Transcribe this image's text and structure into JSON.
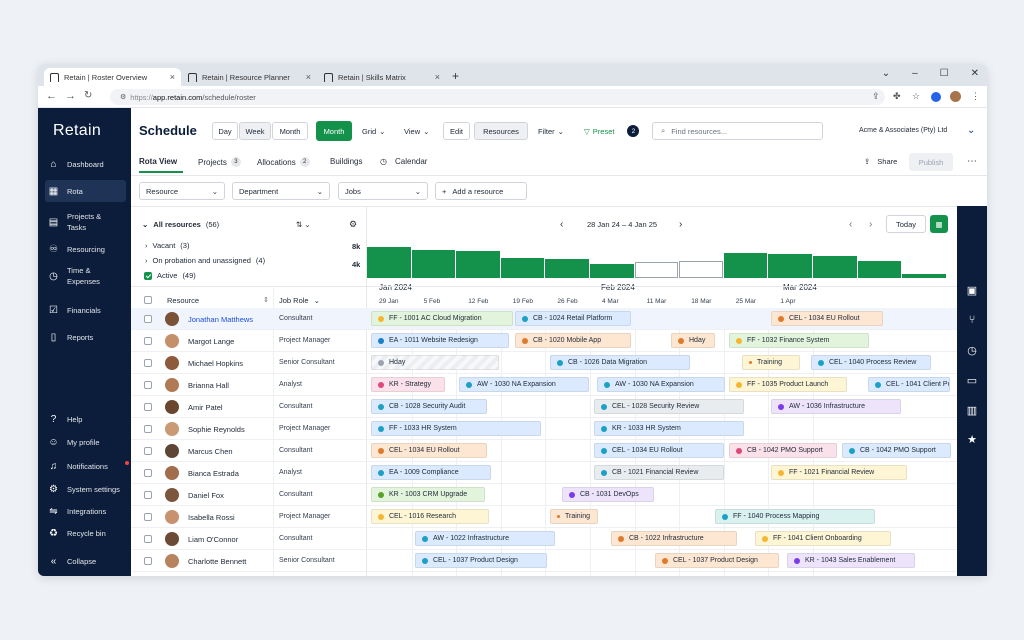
{
  "browser": {
    "tabs": [
      "Retain | Roster Overview",
      "Retain | Resource Planner",
      "Retain | Skills Matrix"
    ],
    "url_prefix": "https://",
    "url_domain": "app.retain.com",
    "url_path": "/schedule/roster"
  },
  "sidebar": {
    "logo": "Retain",
    "items": [
      "Dashboard",
      "Rota",
      "Projects & Tasks",
      "Resourcing",
      "Time & Expenses",
      "Financials",
      "Reports"
    ],
    "bottom": [
      "Help",
      "My profile",
      "Notifications",
      "System settings",
      "Integrations",
      "Recycle bin",
      "Collapse"
    ]
  },
  "header": {
    "title": "Schedule",
    "views": [
      "Day",
      "Week",
      "Month"
    ],
    "month_btn": "Month",
    "grid": "Grid",
    "view": "View",
    "edit": "Edit",
    "resources": "Resources",
    "filter": "Filter",
    "preset": "Preset",
    "preset_count": "2",
    "search_placeholder": "Find resources...",
    "company": "Acme & Associates (Pty) Ltd"
  },
  "subnav": {
    "rota": "Rota View",
    "projects": "Projects",
    "projects_count": "3",
    "allocations": "Allocations",
    "allocations_count": "2",
    "buildings": "Buildings",
    "calendar": "Calendar",
    "share": "Share",
    "publish": "Publish"
  },
  "filters": {
    "resource": "Resource",
    "department": "Department",
    "jobs": "Jobs",
    "add": "Add a resource"
  },
  "groups": {
    "all": "All resources",
    "all_count": "(56)",
    "vacant": "Vacant",
    "vacant_count": "(3)",
    "probation": "On probation and unassigned",
    "probation_count": "(4)",
    "active": "Active",
    "active_count": "(49)",
    "scale_8k": "8k",
    "scale_4k": "4k"
  },
  "timeline": {
    "range": "28 Jan 24 – 4 Jan 25",
    "today": "Today",
    "months": [
      "Jan 2024",
      "Feb 2024",
      "Mar 2024"
    ],
    "ticks": [
      "29 Jan",
      "5 Feb",
      "12 Feb",
      "19 Feb",
      "26 Feb",
      "4 Mar",
      "11 Mar",
      "18 Mar",
      "25 Mar",
      "1 Apr"
    ],
    "hist": [
      0.78,
      0.7,
      0.68,
      0.49,
      0.47,
      0.34,
      0.4,
      0.42,
      0.62,
      0.6,
      0.54,
      0.43,
      0.1
    ],
    "hist_empty": [
      false,
      false,
      false,
      false,
      false,
      false,
      true,
      true,
      false,
      false,
      false,
      false,
      false
    ]
  },
  "columns": {
    "resource": "Resource",
    "role": "Job Role"
  },
  "colors": {
    "blue": "#dbeafe",
    "orange": "#fde7d2",
    "purple": "#ede4fb",
    "pink": "#fbe1ea",
    "yellow": "#fdf5d4",
    "green": "#e2f5dc",
    "grey": "#e9ecef",
    "teal": "#d9f1ef"
  },
  "rows": [
    {
      "name": "Jonathan Matthews",
      "role": "Consultant",
      "bars": [
        {
          "t": "FF - 1001 AC Cloud Migration",
          "c": "green",
          "d": "#f5b731"
        },
        {
          "t": "CB - 1024 Retail Platform",
          "c": "blue",
          "d": "#1ba0c6"
        },
        {
          "t": "CEL - 1034 EU Rollout",
          "c": "orange",
          "d": "#e07a2b"
        }
      ]
    },
    {
      "name": "Margot Lange",
      "role": "Project Manager",
      "bars": [
        {
          "t": "EA - 1011 Website Redesign",
          "c": "blue",
          "d": "#1b7ec6"
        },
        {
          "t": "CB - 1020 Mobile App",
          "c": "orange",
          "d": "#e07a2b"
        },
        {
          "t": "Hday",
          "c": "orange",
          "d": "#e07a2b"
        },
        {
          "t": "FF - 1032 Finance System",
          "c": "green",
          "d": "#f5b731"
        }
      ]
    },
    {
      "name": "Michael Hopkins",
      "role": "Senior Consultant",
      "bars": [
        {
          "t": "Hday",
          "c": "grey",
          "d": "#9ca3af"
        },
        {
          "t": "CB - 1026 Data Migration",
          "c": "blue",
          "d": "#1ba0c6"
        },
        {
          "t": "Training",
          "c": "yellow",
          "d": "#e07a2b"
        },
        {
          "t": "CEL - 1040 Process Review",
          "c": "blue",
          "d": "#1ba0c6"
        }
      ]
    },
    {
      "name": "Brianna Hall",
      "role": "Analyst",
      "bars": [
        {
          "t": "KR - Strategy",
          "c": "pink",
          "d": "#e1487a"
        },
        {
          "t": "AW - 1030 NA Expansion",
          "c": "blue",
          "d": "#1ba0c6"
        },
        {
          "t": "AW - 1030 NA Expansion",
          "c": "blue",
          "d": "#1ba0c6"
        },
        {
          "t": "FF - 1035 Product Launch",
          "c": "yellow",
          "d": "#f5b731"
        },
        {
          "t": "CEL - 1041 Client Por",
          "c": "blue",
          "d": "#1ba0c6"
        }
      ]
    },
    {
      "name": "Amir Patel",
      "role": "Consultant",
      "bars": [
        {
          "t": "CB - 1028 Security Audit",
          "c": "blue",
          "d": "#1ba0c6"
        },
        {
          "t": "CEL - 1028 Security Review",
          "c": "grey",
          "d": "#1ba0c6"
        },
        {
          "t": "AW - 1036 Infrastructure",
          "c": "purple",
          "d": "#7c3aed"
        }
      ]
    },
    {
      "name": "Sophie Reynolds",
      "role": "Project Manager",
      "bars": [
        {
          "t": "FF - 1033 HR System",
          "c": "blue",
          "d": "#1ba0c6"
        },
        {
          "t": "KR - 1033 HR System",
          "c": "blue",
          "d": "#1ba0c6"
        }
      ]
    },
    {
      "name": "Marcus Chen",
      "role": "Consultant",
      "bars": [
        {
          "t": "CEL - 1034 EU Rollout",
          "c": "orange",
          "d": "#e07a2b"
        },
        {
          "t": "CEL - 1034 EU Rollout",
          "c": "blue",
          "d": "#1ba0c6"
        },
        {
          "t": "CB - 1042 PMO Support",
          "c": "pink",
          "d": "#e1487a"
        },
        {
          "t": "CB - 1042 PMO Support",
          "c": "blue",
          "d": "#1ba0c6"
        }
      ]
    },
    {
      "name": "Bianca Estrada",
      "role": "Analyst",
      "bars": [
        {
          "t": "EA - 1009 Compliance",
          "c": "blue",
          "d": "#1ba0c6"
        },
        {
          "t": "CB - 1021 Financial Review",
          "c": "grey",
          "d": "#1ba0c6"
        },
        {
          "t": "FF - 1021 Financial Review",
          "c": "yellow",
          "d": "#f5b731"
        }
      ]
    },
    {
      "name": "Daniel Fox",
      "role": "Consultant",
      "bars": [
        {
          "t": "KR - 1003 CRM Upgrade",
          "c": "green",
          "d": "#5aa02c"
        },
        {
          "t": "CB - 1031 DevOps",
          "c": "purple",
          "d": "#7c3aed"
        }
      ]
    },
    {
      "name": "Isabella Rossi",
      "role": "Project Manager",
      "bars": [
        {
          "t": "CEL - 1016 Research",
          "c": "yellow",
          "d": "#f5b731"
        },
        {
          "t": "Training",
          "c": "orange",
          "d": "#e07a2b"
        },
        {
          "t": "FF - 1040 Process Mapping",
          "c": "teal",
          "d": "#1ba0c6"
        }
      ]
    },
    {
      "name": "Liam O'Connor",
      "role": "Consultant",
      "bars": [
        {
          "t": "AW - 1022 Infrastructure",
          "c": "blue",
          "d": "#1ba0c6"
        },
        {
          "t": "CB - 1022 Infrastructure",
          "c": "orange",
          "d": "#e07a2b"
        },
        {
          "t": "FF - 1041 Client Onboarding",
          "c": "yellow",
          "d": "#f5b731"
        }
      ]
    },
    {
      "name": "Charlotte Bennett",
      "role": "Senior Consultant",
      "bars": [
        {
          "t": "CEL - 1037 Product Design",
          "c": "blue",
          "d": "#1ba0c6"
        },
        {
          "t": "CEL - 1037 Product Design",
          "c": "orange",
          "d": "#e07a2b"
        },
        {
          "t": "KR - 1043 Sales Enablement",
          "c": "purple",
          "d": "#7c3aed"
        }
      ]
    }
  ]
}
